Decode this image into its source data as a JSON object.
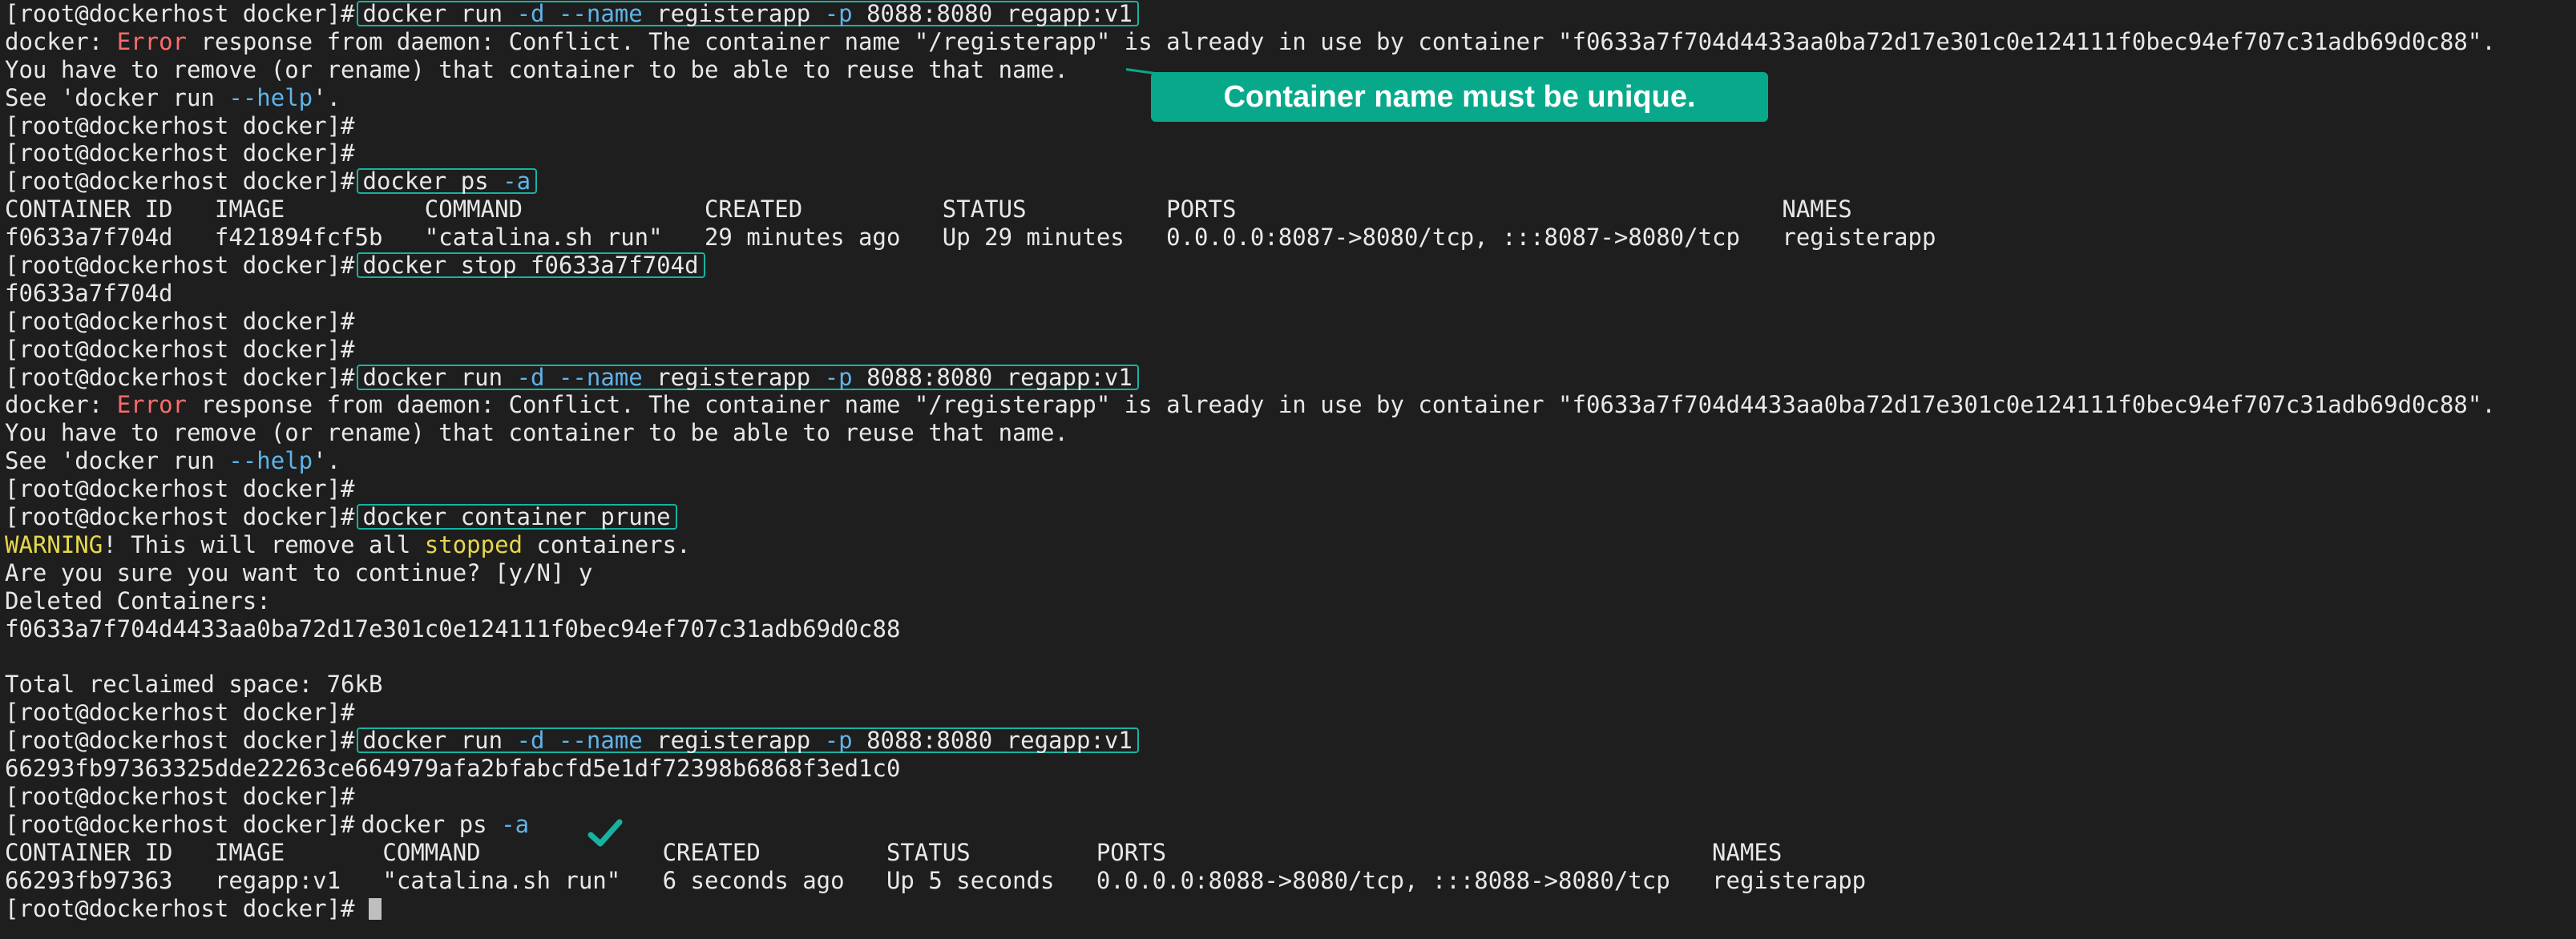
{
  "terminal": {
    "prompt": "[root@dockerhost docker]#",
    "lines": [
      {
        "type": "cmd",
        "boxed": true,
        "cmd_pre": "docker run ",
        "flag1": "-d",
        "mid1": " ",
        "flag2": "--name",
        "mid2": " registerapp ",
        "flag3": "-p",
        "post": " 8088:8080 regapp:v1"
      },
      {
        "type": "error",
        "pre": "docker: ",
        "err": "Error",
        "post": " response from daemon: Conflict. The container name \"/registerapp\" is already in use by container \"f0633a7f704d4433aa0ba72d17e301c0e124111f0bec94ef707c31adb69d0c88\"."
      },
      {
        "type": "text",
        "text": "You have to remove (or rename) that container to be able to reuse that name."
      },
      {
        "type": "help",
        "pre": "See 'docker run ",
        "flag": "--help",
        "post": "'."
      },
      {
        "type": "prompt"
      },
      {
        "type": "prompt"
      },
      {
        "type": "cmd",
        "boxed": true,
        "cmd_pre": "docker ps ",
        "flag1": "-a",
        "mid1": "",
        "flag2": "",
        "mid2": "",
        "flag3": "",
        "post": ""
      },
      {
        "type": "text",
        "text": "CONTAINER ID   IMAGE          COMMAND             CREATED          STATUS          PORTS                                       NAMES"
      },
      {
        "type": "text",
        "text": "f0633a7f704d   f421894fcf5b   \"catalina.sh run\"   29 minutes ago   Up 29 minutes   0.0.0.0:8087->8080/tcp, :::8087->8080/tcp   registerapp"
      },
      {
        "type": "cmd",
        "boxed": true,
        "cmd_pre": "docker stop f0633a7f704d",
        "flag1": "",
        "mid1": "",
        "flag2": "",
        "mid2": "",
        "flag3": "",
        "post": ""
      },
      {
        "type": "text",
        "text": "f0633a7f704d"
      },
      {
        "type": "prompt"
      },
      {
        "type": "prompt"
      },
      {
        "type": "cmd",
        "boxed": true,
        "cmd_pre": "docker run ",
        "flag1": "-d",
        "mid1": " ",
        "flag2": "--name",
        "mid2": " registerapp ",
        "flag3": "-p",
        "post": " 8088:8080 regapp:v1"
      },
      {
        "type": "error",
        "pre": "docker: ",
        "err": "Error",
        "post": " response from daemon: Conflict. The container name \"/registerapp\" is already in use by container \"f0633a7f704d4433aa0ba72d17e301c0e124111f0bec94ef707c31adb69d0c88\"."
      },
      {
        "type": "text",
        "text": "You have to remove (or rename) that container to be able to reuse that name."
      },
      {
        "type": "help",
        "pre": "See 'docker run ",
        "flag": "--help",
        "post": "'."
      },
      {
        "type": "prompt"
      },
      {
        "type": "cmd",
        "boxed": true,
        "cmd_pre": "docker container prune",
        "flag1": "",
        "mid1": "",
        "flag2": "",
        "mid2": "",
        "flag3": "",
        "post": ""
      },
      {
        "type": "warning",
        "w1": "WARNING",
        "t1": "! This will remove all ",
        "w2": "stopped",
        "t2": " containers."
      },
      {
        "type": "text",
        "text": "Are you sure you want to continue? [y/N] y"
      },
      {
        "type": "text",
        "text": "Deleted Containers:"
      },
      {
        "type": "text",
        "text": "f0633a7f704d4433aa0ba72d17e301c0e124111f0bec94ef707c31adb69d0c88"
      },
      {
        "type": "text",
        "text": ""
      },
      {
        "type": "text",
        "text": "Total reclaimed space: 76kB"
      },
      {
        "type": "prompt"
      },
      {
        "type": "cmd",
        "boxed": true,
        "cmd_pre": "docker run ",
        "flag1": "-d",
        "mid1": " ",
        "flag2": "--name",
        "mid2": " registerapp ",
        "flag3": "-p",
        "post": " 8088:8080 regapp:v1"
      },
      {
        "type": "text",
        "text": "66293fb97363325dde22263ce664979afa2bfabcfd5e1df72398b6868f3ed1c0"
      },
      {
        "type": "prompt"
      },
      {
        "type": "cmd",
        "boxed": false,
        "cmd_pre": "docker ps ",
        "flag1": "-a",
        "mid1": "",
        "flag2": "",
        "mid2": "",
        "flag3": "",
        "post": ""
      },
      {
        "type": "text",
        "text": "CONTAINER ID   IMAGE       COMMAND             CREATED         STATUS         PORTS                                       NAMES"
      },
      {
        "type": "text",
        "text": "66293fb97363   regapp:v1   \"catalina.sh run\"   6 seconds ago   Up 5 seconds   0.0.0.0:8088->8080/tcp, :::8088->8080/tcp   registerapp"
      },
      {
        "type": "cursor"
      }
    ]
  },
  "callout": {
    "text": "Container name must be unique."
  },
  "icons": {
    "check": "check-icon"
  },
  "colors": {
    "background": "#1e1e1e",
    "box": "#17b3a0",
    "callout": "#08a98b",
    "flag": "#5fb4ea",
    "error": "#ff6b6b",
    "warning": "#e6d84a"
  }
}
